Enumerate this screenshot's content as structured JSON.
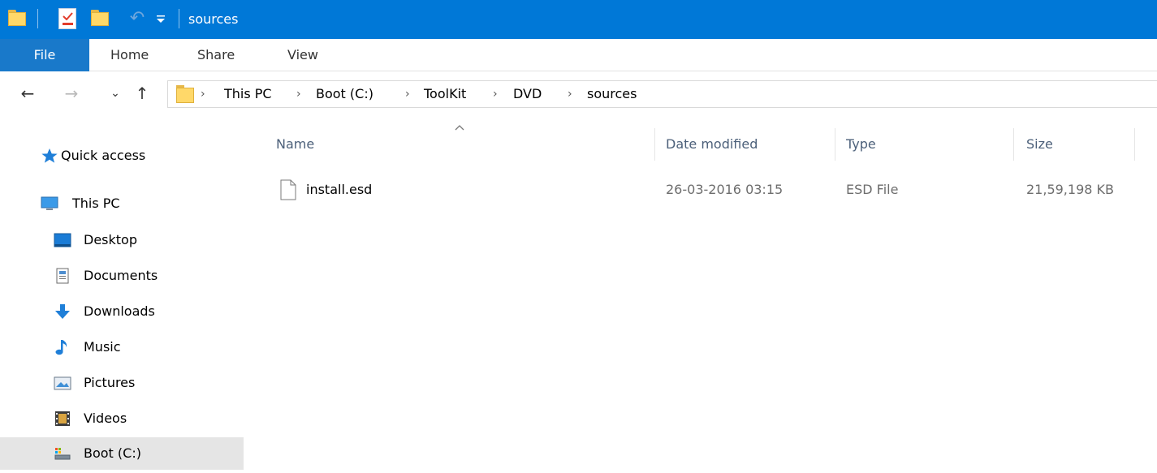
{
  "window": {
    "title": "sources"
  },
  "quick_access_toolbar": {
    "items": [
      "folder-icon",
      "properties-icon",
      "new-folder-icon",
      "undo-icon",
      "customize-dropdown-icon"
    ]
  },
  "ribbon": {
    "tabs": [
      {
        "label": "File",
        "active": true
      },
      {
        "label": "Home"
      },
      {
        "label": "Share"
      },
      {
        "label": "View"
      }
    ],
    "colors": {
      "titlebar": "#0078d7",
      "file_tab": "#1979ca"
    }
  },
  "navigation": {
    "back": "←",
    "forward": "→",
    "recent": "⌄",
    "up": "↑"
  },
  "address_bar": {
    "separator": "›",
    "crumbs": [
      "This PC",
      "Boot (C:)",
      "ToolKit",
      "DVD",
      "sources"
    ]
  },
  "sidebar": {
    "items": [
      {
        "label": "Quick access",
        "icon": "star-icon"
      },
      {
        "label": "This PC",
        "icon": "computer-icon"
      },
      {
        "label": "Desktop",
        "icon": "desktop-icon"
      },
      {
        "label": "Documents",
        "icon": "documents-icon"
      },
      {
        "label": "Downloads",
        "icon": "download-arrow-icon"
      },
      {
        "label": "Music",
        "icon": "music-note-icon"
      },
      {
        "label": "Pictures",
        "icon": "pictures-icon"
      },
      {
        "label": "Videos",
        "icon": "film-icon"
      },
      {
        "label": "Boot (C:)",
        "icon": "drive-icon",
        "selected": true
      }
    ]
  },
  "file_list": {
    "columns": [
      "Name",
      "Date modified",
      "Type",
      "Size"
    ],
    "sort_indicator": "up-caret-icon",
    "rows": [
      {
        "name": "install.esd",
        "date_modified": "26-03-2016 03:15",
        "type": "ESD File",
        "size": "21,59,198 KB",
        "icon": "file-icon"
      }
    ]
  }
}
